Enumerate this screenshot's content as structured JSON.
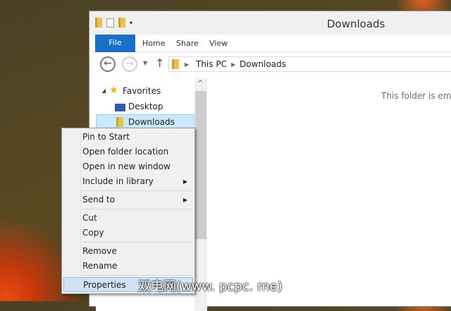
{
  "window": {
    "title": "Downloads",
    "tabs": {
      "file": "File",
      "home": "Home",
      "share": "Share",
      "view": "View"
    }
  },
  "address": {
    "crumbs": [
      "This PC",
      "Downloads"
    ]
  },
  "nav": {
    "favorites": "Favorites",
    "desktop": "Desktop",
    "downloads": "Downloads"
  },
  "content": {
    "empty_text": "This folder is empty."
  },
  "menu": {
    "items": [
      "Pin to Start",
      "Open folder location",
      "Open in new window",
      "Include in library",
      "Send to",
      "Cut",
      "Copy",
      "Remove",
      "Rename",
      "Properties"
    ]
  },
  "watermark": "双电网(www. pcpc. me)"
}
